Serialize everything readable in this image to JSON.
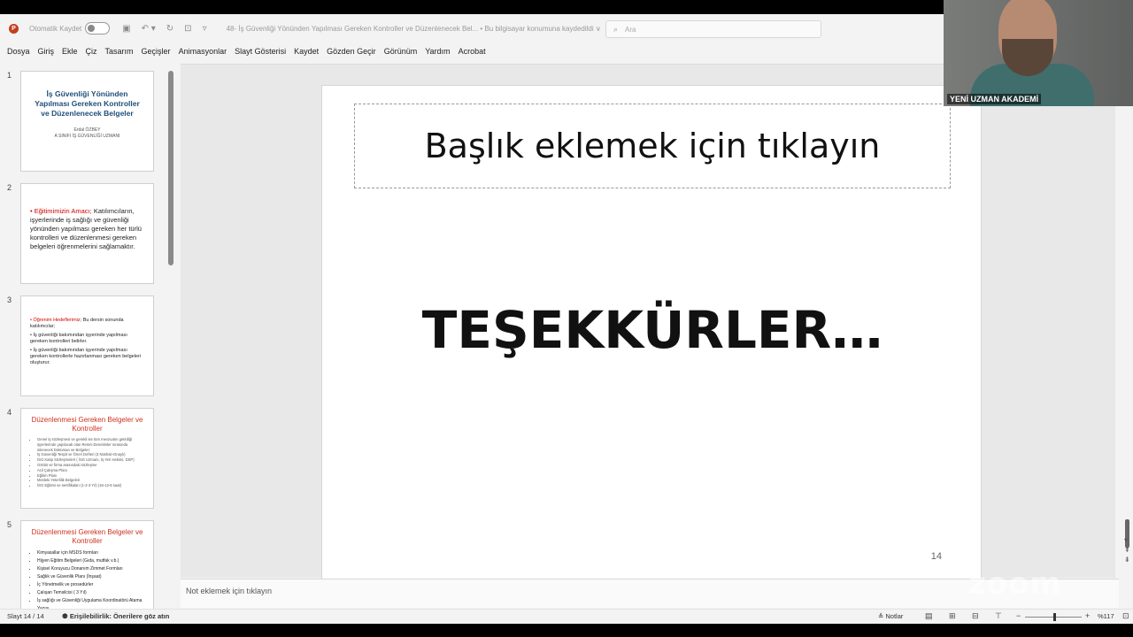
{
  "titlebar": {
    "autosave_label": "Otomatik Kaydet",
    "doc_title": "48- İş Güvenliği Yönünden Yapılması Gereken Kontroller ve Düzenlenecek Bel... • Bu bilgisayar konumuna kaydedildi ∨",
    "search_placeholder": "Ara"
  },
  "menu": [
    "Dosya",
    "Giriş",
    "Ekle",
    "Çiz",
    "Tasarım",
    "Geçişler",
    "Animasyonlar",
    "Slayt Gösterisi",
    "Kaydet",
    "Gözden Geçir",
    "Görünüm",
    "Yardım",
    "Acrobat"
  ],
  "thumbnails": [
    {
      "num": "1",
      "title": "İş Güvenliği Yönünden Yapılması Gereken Kontroller ve Düzenlenecek Belgeler",
      "author": "Erdal ÖZBEY",
      "role": "A SINIFI İŞ GÜVENLİĞİ UZMANI"
    },
    {
      "num": "2",
      "lead": "• Eğitimimizin Amacı;",
      "text": " Katılımcıların, işyerlerinde iş sağlığı ve güvenliği yönünden yapılması gereken her türlü kontrolleri ve düzenlenmesi gereken belgeleri öğrenmelerini sağlamaktır."
    },
    {
      "num": "3",
      "lead": "• Öğrenim Hedeflerimiz;",
      "text": " Bu dersin sonunda katılımcılar;",
      "b1": "• İş güvenliği bakımından işyerinde yapılması gereken kontrolleri belirler.",
      "b2": "• İş güvenliği bakımından işyerinde yapılması gereken kontrollerle hazırlanması gereken belgeleri oluşturur."
    },
    {
      "num": "4",
      "title": "Düzenlenmesi Gereken Belgeler ve Kontroller",
      "items": [
        "Genel iş sözleşmesi ve gerekli ise tüm mevzuatın getirdiği işyerlerinde yapılacak olan Resmi Denetimler sırasında istenecek Doküman ve Belgeler:",
        "İş Güvenliği Tespit ve Öneri Defteri (3 Nüshalı-Onaylı)",
        "İSG Katip Sözleşmeleri ( İSG Uzmanı, İş Yeri Hekimi, DSP)",
        "OSGB ve firma arasındaki sözleşme",
        "Acil Çalışma Planı",
        "Eğitim Planı",
        "Mesleki Yeterlilik Belgeleri",
        "İSG Eğitimi ve sertifikaları (1-2-3 Yıl) (16-12-8 saat)"
      ]
    },
    {
      "num": "5",
      "title": "Düzenlenmesi Gereken Belgeler ve Kontroller",
      "items": [
        "Kimyasallar için MSDS formları",
        "Hijyen Eğitim Belgeleri (Gıda, mutfak v.b.)",
        "Kişisel Koruyucu Donanım Zimmet Formları",
        "Sağlık ve Güvenlik Planı (İnşaat)",
        "İç Yönetmelik ve prosedürler",
        "Çalışan Temsilcisi ( 3 Yıl)",
        "İş sağlığı ve Güvenliği Uygulama Koordinatörü Atama Yazısı"
      ]
    }
  ],
  "slide": {
    "title_placeholder": "Başlık eklemek için tıklayın",
    "body_text": "TEŞEKKÜRLER…",
    "number": "14"
  },
  "notes_placeholder": "Not eklemek için tıklayın",
  "status": {
    "slide_counter": "Slayt 14 / 14",
    "accessibility": "Erişilebilirlik: Önerilere göz atın",
    "notes_label": "Notlar",
    "zoom": "%117"
  },
  "video": {
    "label": "YENİ UZMAN AKADEMİ"
  },
  "watermark": "zoom"
}
